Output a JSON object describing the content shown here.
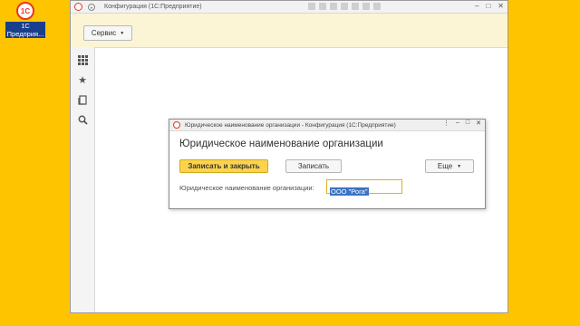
{
  "desktop": {
    "icon_label_1": "1С",
    "icon_label_2": "Предприя...",
    "logo_text": "1С"
  },
  "window": {
    "title": "Конфигурация  (1С:Предприятие)",
    "servis_label": "Сервис"
  },
  "dialog": {
    "title": "Юридическое наименование организации - Конфигурация  (1С:Предприятие)",
    "heading": "Юридическое наименование организации",
    "save_close_label": "Записать и закрыть",
    "save_label": "Записать",
    "more_label": "Еще",
    "field_label": "Юридическое наименование организации:",
    "field_value": "ООО \"Рога\""
  }
}
